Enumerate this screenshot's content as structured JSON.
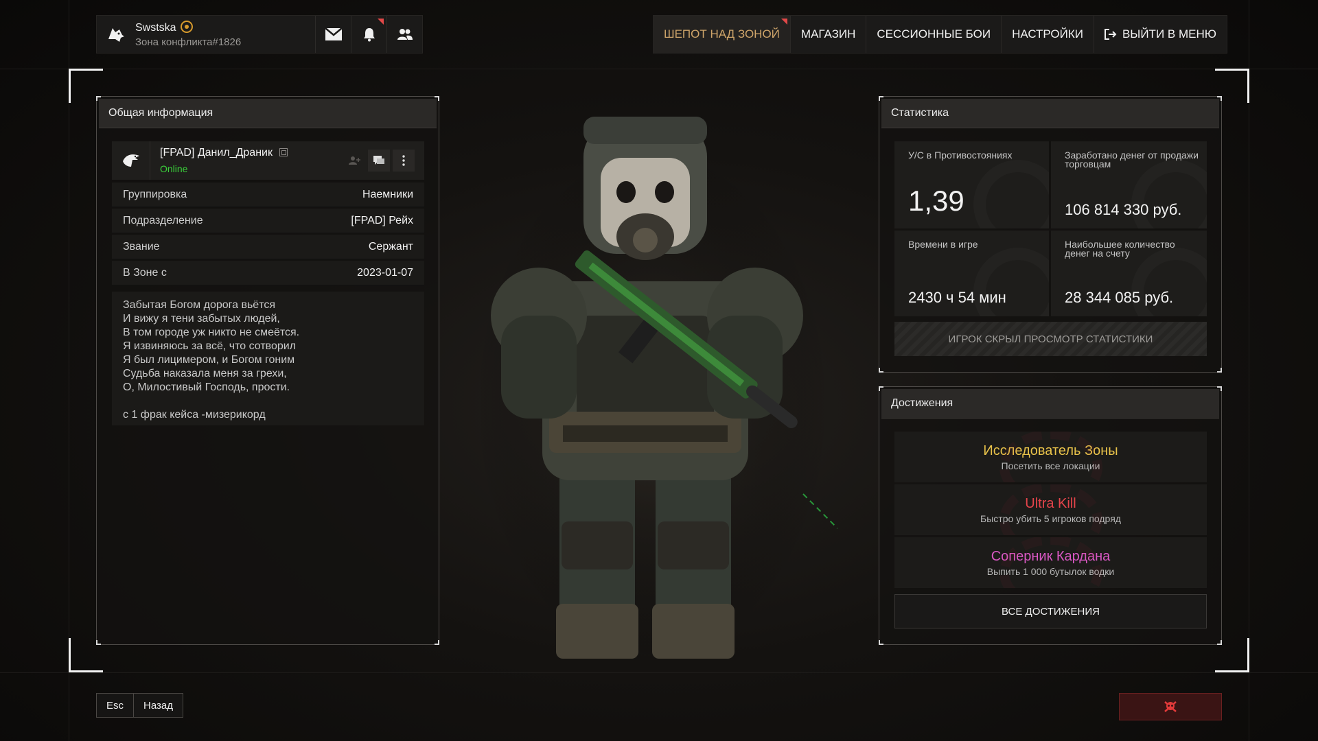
{
  "user": {
    "name": "Swstska",
    "server": "Зона конфликта#1826"
  },
  "nav": [
    "ШЕПОТ НАД ЗОНОЙ",
    "МАГАЗИН",
    "СЕССИОННЫЕ БОИ",
    "НАСТРОЙКИ",
    "ВЫЙТИ В МЕНЮ"
  ],
  "general": {
    "title": "Общая информация",
    "player_name": "[FPAD] Данил_Драник",
    "status": "Online",
    "rows": [
      {
        "k": "Группировка",
        "v": "Наемники"
      },
      {
        "k": "Подразделение",
        "v": "[FPAD] Рейх"
      },
      {
        "k": "Звание",
        "v": "Сержант"
      },
      {
        "k": "В Зоне с",
        "v": "2023-01-07"
      }
    ],
    "bio": [
      "Забытая Богом дорога вьётся",
      "И вижу я тени забытых людей,",
      "В том городе уж никто не смеётся.",
      "Я извиняюсь за всё, что сотворил",
      "Я был лицимером, и Богом гоним",
      "Судьба наказала меня за грехи,",
      "О, Милостивый Господь, прости.",
      "",
      "с 1 фрак кейса -мизерикорд"
    ]
  },
  "stats": {
    "title": "Статистика",
    "kd_label": "У/С в Противостояниях",
    "kd_value": "1,39",
    "earned_label": "Заработано денег от продажи торговцам",
    "earned_value": "106 814 330 руб.",
    "time_label": "Времени в игре",
    "time_value": "2430 ч 54 мин",
    "max_label": "Наибольшее количество денег на счету",
    "max_value": "28 344 085 руб.",
    "hidden_notice": "ИГРОК СКРЫЛ ПРОСМОТР СТАТИСТИКИ"
  },
  "achievements": {
    "title": "Достижения",
    "items": [
      {
        "title": "Исследователь Зоны",
        "desc": "Посетить все локации",
        "color": "#e8c24a"
      },
      {
        "title": "Ultra Kill",
        "desc": "Быстро убить 5 игроков подряд",
        "color": "#e5444b"
      },
      {
        "title": "Соперник Кардана",
        "desc": "Выпить 1 000 бутылок водки",
        "color": "#d958c4"
      }
    ],
    "all_button": "ВСЕ ДОСТИЖЕНИЯ"
  },
  "footer": {
    "esc_key": "Esc",
    "back_label": "Назад"
  },
  "colors": {
    "accent": "#cfa56a",
    "online": "#3bd13b",
    "alert": "#e14848"
  },
  "icons": [
    "wolf-emblem-icon",
    "mail-icon",
    "bell-icon",
    "friends-icon",
    "exit-icon",
    "copy-icon",
    "add-friend-icon",
    "chat-icon",
    "more-icon",
    "skull-icon",
    "eagle-emblem-icon"
  ]
}
